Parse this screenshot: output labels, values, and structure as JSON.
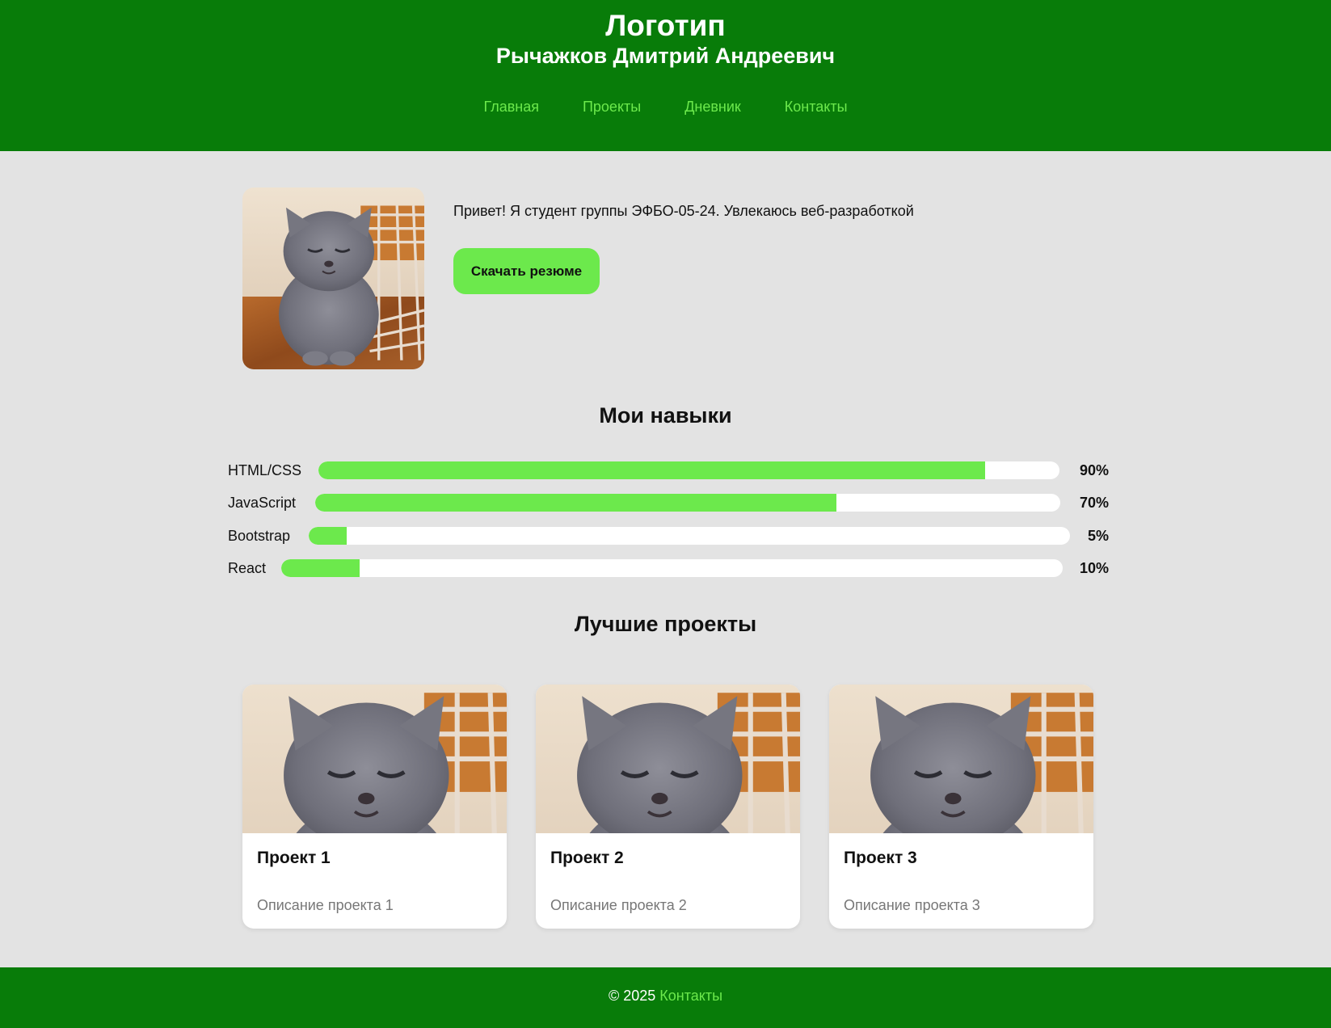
{
  "header": {
    "logo": "Логотип",
    "owner_name": "Рычажков Дмитрий Андреевич",
    "nav": [
      {
        "label": "Главная"
      },
      {
        "label": "Проекты"
      },
      {
        "label": "Дневник"
      },
      {
        "label": "Контакты"
      }
    ]
  },
  "hero": {
    "photo": "kitten-photo",
    "intro": "Привет! Я студент группы ЭФБО-05-24. Увлекаюсь веб-разработкой",
    "resume_label": "Скачать резюме"
  },
  "skills": {
    "title": "Мои навыки",
    "items": [
      {
        "name": "HTML/CSS",
        "percent_label": "90%",
        "level": 0.9
      },
      {
        "name": "JavaScript",
        "percent_label": "70%",
        "level": 0.7
      },
      {
        "name": "Bootstrap",
        "percent_label": "5%",
        "level": 0.05
      },
      {
        "name": "React",
        "percent_label": "10%",
        "level": 0.1
      }
    ]
  },
  "projects": {
    "title": "Лучшие проекты",
    "items": [
      {
        "title": "Проект 1",
        "description": "Описание проекта 1",
        "image": "kitten-photo"
      },
      {
        "title": "Проект 2",
        "description": "Описание проекта 2",
        "image": "kitten-photo"
      },
      {
        "title": "Проект 3",
        "description": "Описание проекта 3",
        "image": "kitten-photo"
      }
    ]
  },
  "footer": {
    "copyright": "© 2025",
    "contacts_link": "Контакты"
  },
  "colors": {
    "header_bg": "#087c09",
    "accent": "#6ce94c",
    "page_bg": "#e3e3e3"
  }
}
